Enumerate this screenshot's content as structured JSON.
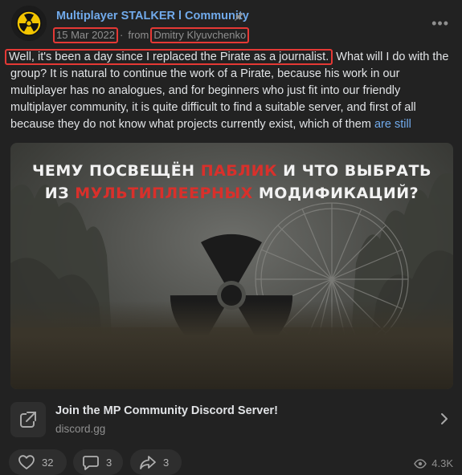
{
  "post": {
    "group_name": "Multiplayer STALKER l Community",
    "date": "15 Mar 2022",
    "from_label": "from",
    "author": "Dmitry Klyuvchenko",
    "text_highlight": "Well, it's been a day since I replaced the Pirate as a journalist.",
    "text_rest": " What will I do with the group? It is natural to continue the work of a Pirate, because his work in our multiplayer has no analogues, and for beginners who just fit into our friendly multiplayer community, it is quite difficult to find a suitable server, and first of all because they do not know what projects currently exist, which of them ",
    "text_more": "are still"
  },
  "image": {
    "line1_a": "ЧЕМУ ПОСВЕЩЁН ",
    "line1_red": "ПАБЛИК",
    "line1_b": " И ЧТО ВЫБРАТЬ",
    "line2_a": "ИЗ ",
    "line2_red": "МУЛЬТИПЛЕЕРНЫХ",
    "line2_b": " МОДИФИКАЦИЙ?"
  },
  "link": {
    "title": "Join the MP Community Discord Server!",
    "domain": "discord.gg"
  },
  "actions": {
    "likes": "32",
    "comments": "3",
    "shares": "3",
    "views": "4.3K"
  },
  "colors": {
    "accent": "#71aaeb",
    "highlight_border": "#e53935",
    "background": "#222222"
  }
}
